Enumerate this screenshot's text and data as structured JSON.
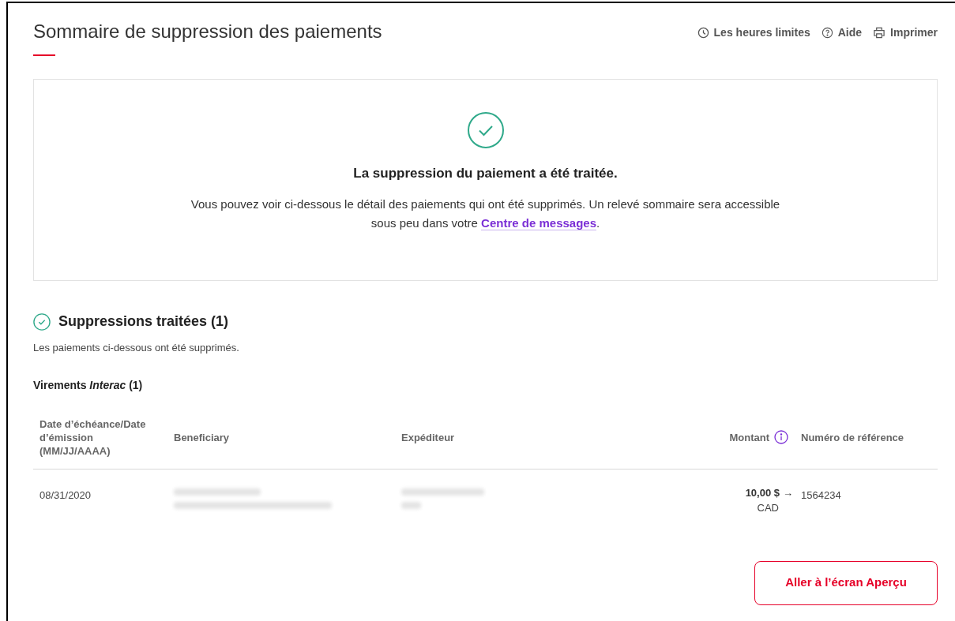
{
  "header": {
    "title": "Sommaire de suppression des paiements",
    "links": [
      {
        "kind": "clock",
        "label": "Les heures limites"
      },
      {
        "kind": "help",
        "label": "Aide"
      },
      {
        "kind": "print",
        "label": "Imprimer"
      }
    ]
  },
  "confirmation": {
    "heading": "La suppression du paiement a été traitée.",
    "message": "Vous pouvez voir ci-dessous le détail des paiements qui ont été supprimés. Un relevé sommaire sera accessible sous peu dans votre",
    "link": "Centre de messages",
    "after_link": "."
  },
  "section": {
    "heading": "Suppressions traitées (1)",
    "description": "Les paiements ci-dessous ont été supprimés.",
    "group_title": "Virements *Interac* (1)"
  },
  "table": {
    "columns": [
      "Date d’échéance/Date d’émission (MM/JJ/AAAA)",
      "Beneficiary",
      "Expéditeur",
      "Montant",
      "Numéro de référence"
    ],
    "rows": [
      {
        "date": "08/31/2020",
        "amount": "10,00 $",
        "arrow": "→",
        "currency": "CAD",
        "reference": "1564234"
      }
    ]
  },
  "button": "Aller à l’écran Aperçu"
}
